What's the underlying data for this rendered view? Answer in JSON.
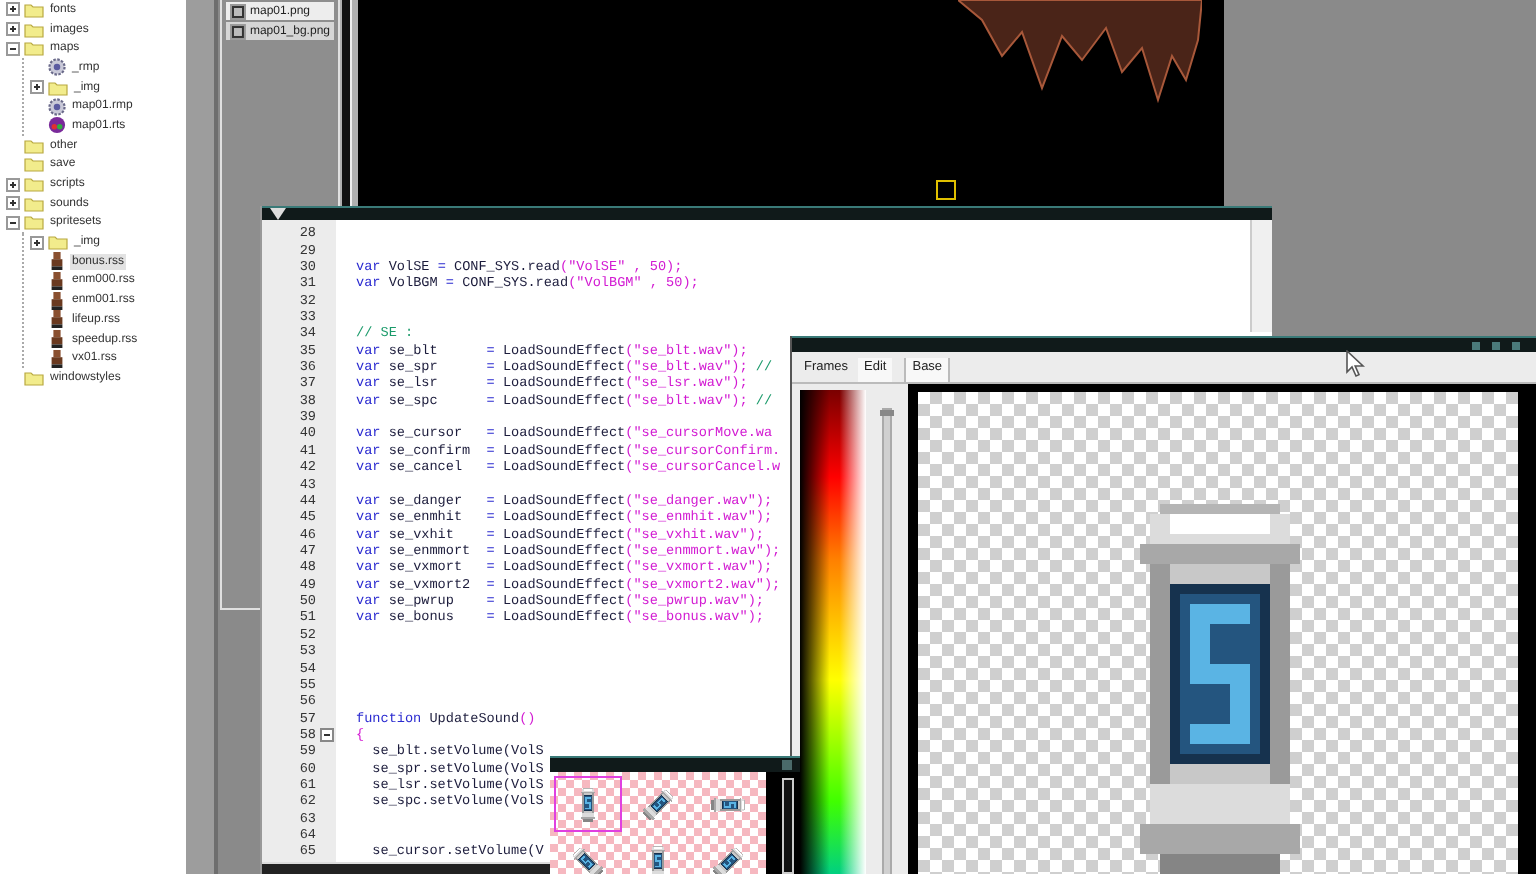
{
  "file_tree": {
    "items": [
      {
        "name": "fonts",
        "kind": "folder",
        "expanded": false,
        "selected": false
      },
      {
        "name": "images",
        "kind": "folder",
        "expanded": false,
        "selected": false
      },
      {
        "name": "maps",
        "kind": "folder",
        "expanded": true,
        "selected": false,
        "children": [
          {
            "name": "_rmp",
            "kind": "map",
            "selected": false
          },
          {
            "name": "_img",
            "kind": "folder",
            "expanded": false,
            "selected": false
          },
          {
            "name": "map01.rmp",
            "kind": "map",
            "selected": false
          },
          {
            "name": "map01.rts",
            "kind": "tileset",
            "selected": false
          }
        ]
      },
      {
        "name": "other",
        "kind": "folder",
        "selected": false
      },
      {
        "name": "save",
        "kind": "folder",
        "selected": false
      },
      {
        "name": "scripts",
        "kind": "folder",
        "expanded": false,
        "selected": false
      },
      {
        "name": "sounds",
        "kind": "folder",
        "expanded": false,
        "selected": false
      },
      {
        "name": "spritesets",
        "kind": "folder",
        "expanded": true,
        "selected": false,
        "children": [
          {
            "name": "_img",
            "kind": "folder",
            "expanded": false,
            "selected": false
          },
          {
            "name": "bonus.rss",
            "kind": "spriteset",
            "selected": true
          },
          {
            "name": "enm000.rss",
            "kind": "spriteset",
            "selected": false
          },
          {
            "name": "enm001.rss",
            "kind": "spriteset",
            "selected": false
          },
          {
            "name": "lifeup.rss",
            "kind": "spriteset",
            "selected": false
          },
          {
            "name": "speedup.rss",
            "kind": "spriteset",
            "selected": false
          },
          {
            "name": "vx01.rss",
            "kind": "spriteset",
            "selected": false
          }
        ]
      },
      {
        "name": "windowstyles",
        "kind": "folder",
        "selected": false
      }
    ]
  },
  "file_list": {
    "items": [
      {
        "name": "map01.png",
        "selected": true
      },
      {
        "name": "map01_bg.png",
        "selected": false
      }
    ]
  },
  "code_editor": {
    "lines": [
      {
        "number": "28"
      },
      {
        "number": "29"
      },
      {
        "number": "30",
        "tokens": [
          {
            "kind": "keyword",
            "text": "var"
          },
          {
            "kind": "plain",
            "text": " VolSE "
          },
          {
            "kind": "keyword",
            "text": "="
          },
          {
            "kind": "plain",
            "text": " CONF_SYS.read"
          },
          {
            "kind": "string",
            "text": "(\"VolSE\" , 50);"
          }
        ]
      },
      {
        "number": "31",
        "tokens": [
          {
            "kind": "keyword",
            "text": "var"
          },
          {
            "kind": "plain",
            "text": " VolBGM "
          },
          {
            "kind": "keyword",
            "text": "="
          },
          {
            "kind": "plain",
            "text": " CONF_SYS.read"
          },
          {
            "kind": "string",
            "text": "(\"VolBGM\" , 50);"
          }
        ]
      },
      {
        "number": "32"
      },
      {
        "number": "33"
      },
      {
        "number": "34",
        "tokens": [
          {
            "kind": "comment",
            "text": "// SE :"
          }
        ]
      },
      {
        "number": "35",
        "tokens": [
          {
            "kind": "keyword",
            "text": "var"
          },
          {
            "kind": "plain",
            "text": " se_blt      "
          },
          {
            "kind": "keyword",
            "text": "="
          },
          {
            "kind": "plain",
            "text": " LoadSoundEffect"
          },
          {
            "kind": "string",
            "text": "(\"se_blt.wav\");"
          }
        ]
      },
      {
        "number": "36",
        "tokens": [
          {
            "kind": "keyword",
            "text": "var"
          },
          {
            "kind": "plain",
            "text": " se_spr      "
          },
          {
            "kind": "keyword",
            "text": "="
          },
          {
            "kind": "plain",
            "text": " LoadSoundEffect"
          },
          {
            "kind": "string",
            "text": "(\"se_blt.wav\");"
          },
          {
            "kind": "comment",
            "text": " //"
          }
        ]
      },
      {
        "number": "37",
        "tokens": [
          {
            "kind": "keyword",
            "text": "var"
          },
          {
            "kind": "plain",
            "text": " se_lsr      "
          },
          {
            "kind": "keyword",
            "text": "="
          },
          {
            "kind": "plain",
            "text": " LoadSoundEffect"
          },
          {
            "kind": "string",
            "text": "(\"se_lsr.wav\");"
          }
        ]
      },
      {
        "number": "38",
        "tokens": [
          {
            "kind": "keyword",
            "text": "var"
          },
          {
            "kind": "plain",
            "text": " se_spc      "
          },
          {
            "kind": "keyword",
            "text": "="
          },
          {
            "kind": "plain",
            "text": " LoadSoundEffect"
          },
          {
            "kind": "string",
            "text": "(\"se_blt.wav\");"
          },
          {
            "kind": "comment",
            "text": " //"
          }
        ]
      },
      {
        "number": "39"
      },
      {
        "number": "40",
        "tokens": [
          {
            "kind": "keyword",
            "text": "var"
          },
          {
            "kind": "plain",
            "text": " se_cursor   "
          },
          {
            "kind": "keyword",
            "text": "="
          },
          {
            "kind": "plain",
            "text": " LoadSoundEffect"
          },
          {
            "kind": "string",
            "text": "(\"se_cursorMove.wa"
          }
        ]
      },
      {
        "number": "41",
        "tokens": [
          {
            "kind": "keyword",
            "text": "var"
          },
          {
            "kind": "plain",
            "text": " se_confirm  "
          },
          {
            "kind": "keyword",
            "text": "="
          },
          {
            "kind": "plain",
            "text": " LoadSoundEffect"
          },
          {
            "kind": "string",
            "text": "(\"se_cursorConfirm."
          }
        ]
      },
      {
        "number": "42",
        "tokens": [
          {
            "kind": "keyword",
            "text": "var"
          },
          {
            "kind": "plain",
            "text": " se_cancel   "
          },
          {
            "kind": "keyword",
            "text": "="
          },
          {
            "kind": "plain",
            "text": " LoadSoundEffect"
          },
          {
            "kind": "string",
            "text": "(\"se_cursorCancel.w"
          }
        ]
      },
      {
        "number": "43"
      },
      {
        "number": "44",
        "tokens": [
          {
            "kind": "keyword",
            "text": "var"
          },
          {
            "kind": "plain",
            "text": " se_danger   "
          },
          {
            "kind": "keyword",
            "text": "="
          },
          {
            "kind": "plain",
            "text": " LoadSoundEffect"
          },
          {
            "kind": "string",
            "text": "(\"se_danger.wav\");"
          }
        ]
      },
      {
        "number": "45",
        "tokens": [
          {
            "kind": "keyword",
            "text": "var"
          },
          {
            "kind": "plain",
            "text": " se_enmhit   "
          },
          {
            "kind": "keyword",
            "text": "="
          },
          {
            "kind": "plain",
            "text": " LoadSoundEffect"
          },
          {
            "kind": "string",
            "text": "(\"se_enmhit.wav\");"
          }
        ]
      },
      {
        "number": "46",
        "tokens": [
          {
            "kind": "keyword",
            "text": "var"
          },
          {
            "kind": "plain",
            "text": " se_vxhit    "
          },
          {
            "kind": "keyword",
            "text": "="
          },
          {
            "kind": "plain",
            "text": " LoadSoundEffect"
          },
          {
            "kind": "string",
            "text": "(\"se_vxhit.wav\");"
          }
        ]
      },
      {
        "number": "47",
        "tokens": [
          {
            "kind": "keyword",
            "text": "var"
          },
          {
            "kind": "plain",
            "text": " se_enmmort  "
          },
          {
            "kind": "keyword",
            "text": "="
          },
          {
            "kind": "plain",
            "text": " LoadSoundEffect"
          },
          {
            "kind": "string",
            "text": "(\"se_enmmort.wav\");"
          }
        ]
      },
      {
        "number": "48",
        "tokens": [
          {
            "kind": "keyword",
            "text": "var"
          },
          {
            "kind": "plain",
            "text": " se_vxmort   "
          },
          {
            "kind": "keyword",
            "text": "="
          },
          {
            "kind": "plain",
            "text": " LoadSoundEffect"
          },
          {
            "kind": "string",
            "text": "(\"se_vxmort.wav\");"
          }
        ]
      },
      {
        "number": "49",
        "tokens": [
          {
            "kind": "keyword",
            "text": "var"
          },
          {
            "kind": "plain",
            "text": " se_vxmort2  "
          },
          {
            "kind": "keyword",
            "text": "="
          },
          {
            "kind": "plain",
            "text": " LoadSoundEffect"
          },
          {
            "kind": "string",
            "text": "(\"se_vxmort2.wav\");"
          }
        ]
      },
      {
        "number": "50",
        "tokens": [
          {
            "kind": "keyword",
            "text": "var"
          },
          {
            "kind": "plain",
            "text": " se_pwrup    "
          },
          {
            "kind": "keyword",
            "text": "="
          },
          {
            "kind": "plain",
            "text": " LoadSoundEffect"
          },
          {
            "kind": "string",
            "text": "(\"se_pwrup.wav\");"
          }
        ]
      },
      {
        "number": "51",
        "tokens": [
          {
            "kind": "keyword",
            "text": "var"
          },
          {
            "kind": "plain",
            "text": " se_bonus    "
          },
          {
            "kind": "keyword",
            "text": "="
          },
          {
            "kind": "plain",
            "text": " LoadSoundEffect"
          },
          {
            "kind": "string",
            "text": "(\"se_bonus.wav\");"
          }
        ]
      },
      {
        "number": "52"
      },
      {
        "number": "53"
      },
      {
        "number": "54"
      },
      {
        "number": "55"
      },
      {
        "number": "56"
      },
      {
        "number": "57",
        "tokens": [
          {
            "kind": "keyword",
            "text": "function"
          },
          {
            "kind": "plain",
            "text": " UpdateSound"
          },
          {
            "kind": "string",
            "text": "()"
          }
        ]
      },
      {
        "number": "58",
        "fold": true,
        "tokens": [
          {
            "kind": "string",
            "text": "{"
          }
        ]
      },
      {
        "number": "59",
        "tokens": [
          {
            "kind": "plain",
            "text": "  se_blt.setVolume(VolS"
          }
        ]
      },
      {
        "number": "60",
        "tokens": [
          {
            "kind": "plain",
            "text": "  se_spr.setVolume(VolS"
          }
        ]
      },
      {
        "number": "61",
        "tokens": [
          {
            "kind": "plain",
            "text": "  se_lsr.setVolume(VolS"
          }
        ]
      },
      {
        "number": "62",
        "tokens": [
          {
            "kind": "plain",
            "text": "  se_spc.setVolume(VolS"
          }
        ]
      },
      {
        "number": "63"
      },
      {
        "number": "64"
      },
      {
        "number": "65",
        "tokens": [
          {
            "kind": "plain",
            "text": "  se_cursor.setVolume(V"
          }
        ]
      }
    ]
  },
  "sprite_editor": {
    "tabs": [
      {
        "label": "Frames",
        "selected": false
      },
      {
        "label": "Edit",
        "selected": true
      }
    ],
    "layer_tabs": [
      {
        "label": "Base",
        "selected": true
      }
    ],
    "alpha_slider": {
      "level": 1
    }
  },
  "sprite_sheet": {
    "frames": [
      {
        "kind": "upright",
        "selected": true
      },
      {
        "kind": "tilt-right",
        "selected": false
      },
      {
        "kind": "sideways",
        "selected": false
      },
      {
        "kind": "tilt-left",
        "selected": false
      },
      {
        "kind": "upright",
        "selected": false
      },
      {
        "kind": "tilt-right",
        "selected": false
      }
    ]
  }
}
